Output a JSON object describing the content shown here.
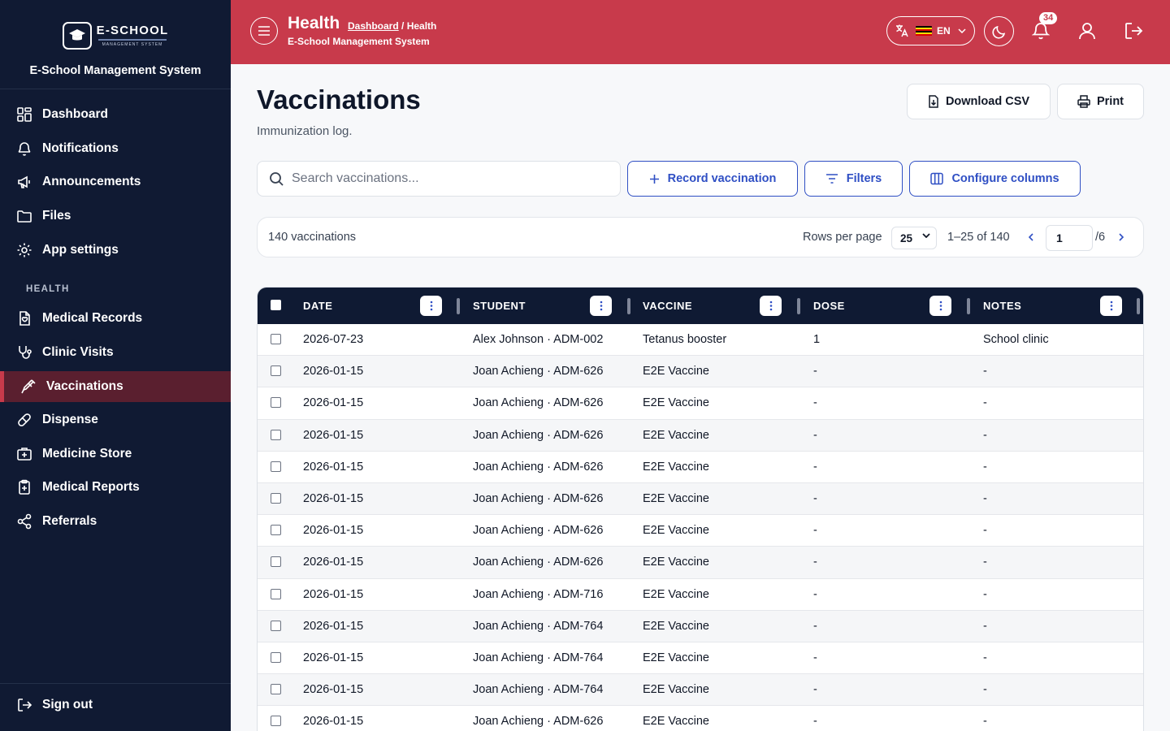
{
  "brand": {
    "logo_name": "E-SCHOOL",
    "logo_sub": "MANAGEMENT SYSTEM",
    "system_name": "E-School Management System"
  },
  "sidebar": {
    "items": [
      {
        "label": "Dashboard",
        "icon": "grid-icon"
      },
      {
        "label": "Notifications",
        "icon": "bell-icon"
      },
      {
        "label": "Announcements",
        "icon": "megaphone-icon"
      },
      {
        "label": "Files",
        "icon": "folder-icon"
      },
      {
        "label": "App settings",
        "icon": "gear-icon"
      }
    ],
    "section_label": "HEALTH",
    "health_items": [
      {
        "label": "Medical Records",
        "icon": "file-heart-icon"
      },
      {
        "label": "Clinic Visits",
        "icon": "stethoscope-icon"
      },
      {
        "label": "Vaccinations",
        "icon": "syringe-icon",
        "active": true
      },
      {
        "label": "Dispense",
        "icon": "pill-icon"
      },
      {
        "label": "Medicine Store",
        "icon": "medical-kit-icon"
      },
      {
        "label": "Medical Reports",
        "icon": "clipboard-icon"
      },
      {
        "label": "Referrals",
        "icon": "share-icon"
      }
    ],
    "sign_out": "Sign out"
  },
  "header": {
    "title": "Health",
    "breadcrumb_link": "Dashboard",
    "breadcrumb_current": "/ Health",
    "subtitle": "E-School Management System",
    "language": "EN",
    "notification_count": "34",
    "accent_color": "#c83a4b"
  },
  "page": {
    "title": "Vaccinations",
    "subtitle": "Immunization log.",
    "download_label": "Download CSV",
    "print_label": "Print",
    "search_placeholder": "Search vaccinations...",
    "record_label": "Record vaccination",
    "filters_label": "Filters",
    "columns_label": "Configure columns"
  },
  "pagination": {
    "count_label": "140 vaccinations",
    "rows_per_page_label": "Rows per page",
    "rows_per_page": "25",
    "range_label": "1–25 of 140",
    "current_page": "1",
    "total_pages": "/6"
  },
  "table": {
    "columns": [
      "DATE",
      "STUDENT",
      "VACCINE",
      "DOSE",
      "NOTES"
    ],
    "rows": [
      [
        "2026-07-23",
        "Alex Johnson · ADM-002",
        "Tetanus booster",
        "1",
        "School clinic"
      ],
      [
        "2026-01-15",
        "Joan Achieng · ADM-626",
        "E2E Vaccine",
        "-",
        "-"
      ],
      [
        "2026-01-15",
        "Joan Achieng · ADM-626",
        "E2E Vaccine",
        "-",
        "-"
      ],
      [
        "2026-01-15",
        "Joan Achieng · ADM-626",
        "E2E Vaccine",
        "-",
        "-"
      ],
      [
        "2026-01-15",
        "Joan Achieng · ADM-626",
        "E2E Vaccine",
        "-",
        "-"
      ],
      [
        "2026-01-15",
        "Joan Achieng · ADM-626",
        "E2E Vaccine",
        "-",
        "-"
      ],
      [
        "2026-01-15",
        "Joan Achieng · ADM-626",
        "E2E Vaccine",
        "-",
        "-"
      ],
      [
        "2026-01-15",
        "Joan Achieng · ADM-626",
        "E2E Vaccine",
        "-",
        "-"
      ],
      [
        "2026-01-15",
        "Joan Achieng · ADM-716",
        "E2E Vaccine",
        "-",
        "-"
      ],
      [
        "2026-01-15",
        "Joan Achieng · ADM-764",
        "E2E Vaccine",
        "-",
        "-"
      ],
      [
        "2026-01-15",
        "Joan Achieng · ADM-764",
        "E2E Vaccine",
        "-",
        "-"
      ],
      [
        "2026-01-15",
        "Joan Achieng · ADM-764",
        "E2E Vaccine",
        "-",
        "-"
      ],
      [
        "2026-01-15",
        "Joan Achieng · ADM-626",
        "E2E Vaccine",
        "-",
        "-"
      ]
    ]
  }
}
